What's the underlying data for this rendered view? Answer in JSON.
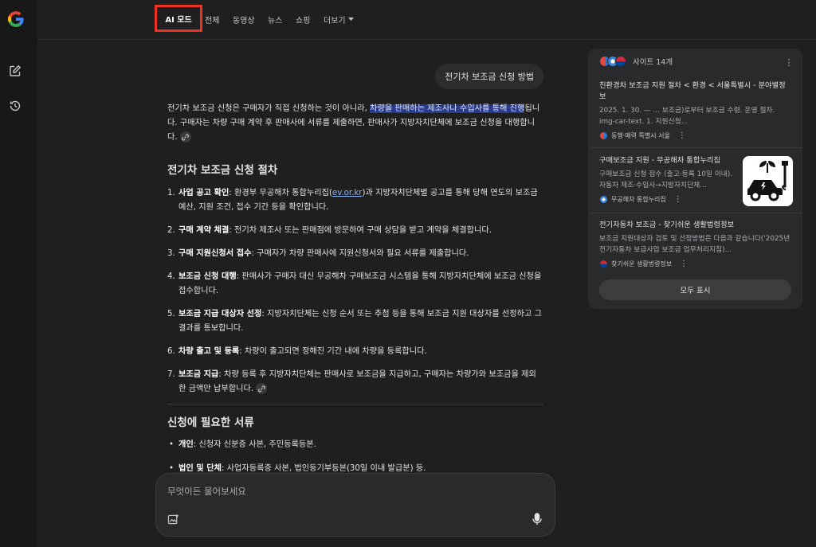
{
  "nav": {
    "tabs": [
      {
        "label": "AI 모드"
      },
      {
        "label": "전체"
      },
      {
        "label": "동영상"
      },
      {
        "label": "뉴스"
      },
      {
        "label": "쇼핑"
      },
      {
        "label": "더보기"
      }
    ]
  },
  "query": "전기차 보조금 신청 방법",
  "answer": {
    "intro_pre": "전기차 보조금 신청은 구매자가 직접 신청하는 것이 아니라, ",
    "intro_highlight": "차량을 판매하는 제조사나 수입사를 통해 진행",
    "intro_post": "됩니다. 구매자는 차량 구매 계약 후 판매사에 서류를 제출하면, 판매사가 지방자치단체에 보조금 신청을 대행합니다.",
    "steps_heading": "전기차 보조금 신청 절차",
    "steps": [
      {
        "num": "1.",
        "bold": "사업 공고 확인",
        "pre": ": 환경부 무공해차 통합누리집(",
        "link": "ev.or.kr",
        "text": ")과 지방자치단체별 공고를 통해 당해 연도의 보조금 예산, 지원 조건, 접수 기간 등을 확인합니다."
      },
      {
        "num": "2.",
        "bold": "구매 계약 체결",
        "text": ": 전기차 제조사 또는 판매점에 방문하여 구매 상담을 받고 계약을 체결합니다."
      },
      {
        "num": "3.",
        "bold": "구매 지원신청서 접수",
        "text": ": 구매자가 차량 판매사에 지원신청서와 필요 서류를 제출합니다."
      },
      {
        "num": "4.",
        "bold": "보조금 신청 대행",
        "text": ": 판매사가 구매자 대신 무공해차 구매보조금 시스템을 통해 지방자치단체에 보조금 신청을 접수합니다."
      },
      {
        "num": "5.",
        "bold": "보조금 지급 대상자 선정",
        "text": ": 지방자치단체는 신청 순서 또는 추첨 등을 통해 보조금 지원 대상자를 선정하고 그 결과를 통보합니다."
      },
      {
        "num": "6.",
        "bold": "차량 출고 및 등록",
        "text": ": 차량이 출고되면 정해진 기간 내에 차량을 등록합니다."
      },
      {
        "num": "7.",
        "bold": "보조금 지급",
        "text": ": 차량 등록 후 지방자치단체는 판매사로 보조금을 지급하고, 구매자는 차량가와 보조금을 제외한 금액만 납부합니다."
      }
    ],
    "docs_heading": "신청에 필요한 서류",
    "docs": [
      {
        "bold": "개인",
        "text": ": 신청자 신분증 사본, 주민등록등본."
      },
      {
        "bold": "법인 및 단체",
        "text": ": 사업자등록증 사본, 법인등기부등본(30일 이내 발급분) 등."
      }
    ]
  },
  "ask": {
    "placeholder": "무엇이든 물어보세요"
  },
  "sources": {
    "header": "사이트 14개",
    "items": [
      {
        "title": "친환경차 보조금 지원 절차 < 환경 < 서울특별시 - 분야별정보",
        "snippet": "2025. 1. 30. — ... 보조금)로부터 보조금 수령. 운영 절차. img-car-text. 1. 지원신청...",
        "site": "동행·매력 특별시 서울"
      },
      {
        "title": "구매보조금 지원 - 무공해차 통합누리집",
        "snippet": "구매보조금 신청 접수 (출고·등록 10일 이내). 자동차 제조·수입사→지방자치단체...",
        "site": "무공해차 통합누리집"
      },
      {
        "title": "전기자동차 보조금 - 찾기쉬운 생활법령정보",
        "snippet": "보조금 지원대상자 검토 및 선정방법은 다음과 같습니다('2025년 전기자동차 보급사업 보조금 업무처리지침)...",
        "site": "찾기쉬운 생활법령정보"
      }
    ],
    "show_all": "모두 표시"
  },
  "colors": {
    "background": "#1f1f1f",
    "panel": "#282a2c",
    "highlight": "#2a3a8a",
    "link": "#8ab4f8",
    "annotation_box": "#ea3323"
  },
  "icons": [
    "google-logo-icon",
    "new-chat-icon",
    "history-icon",
    "chevron-down-icon",
    "link-icon",
    "image-upload-icon",
    "microphone-icon",
    "more-vert-icon"
  ]
}
